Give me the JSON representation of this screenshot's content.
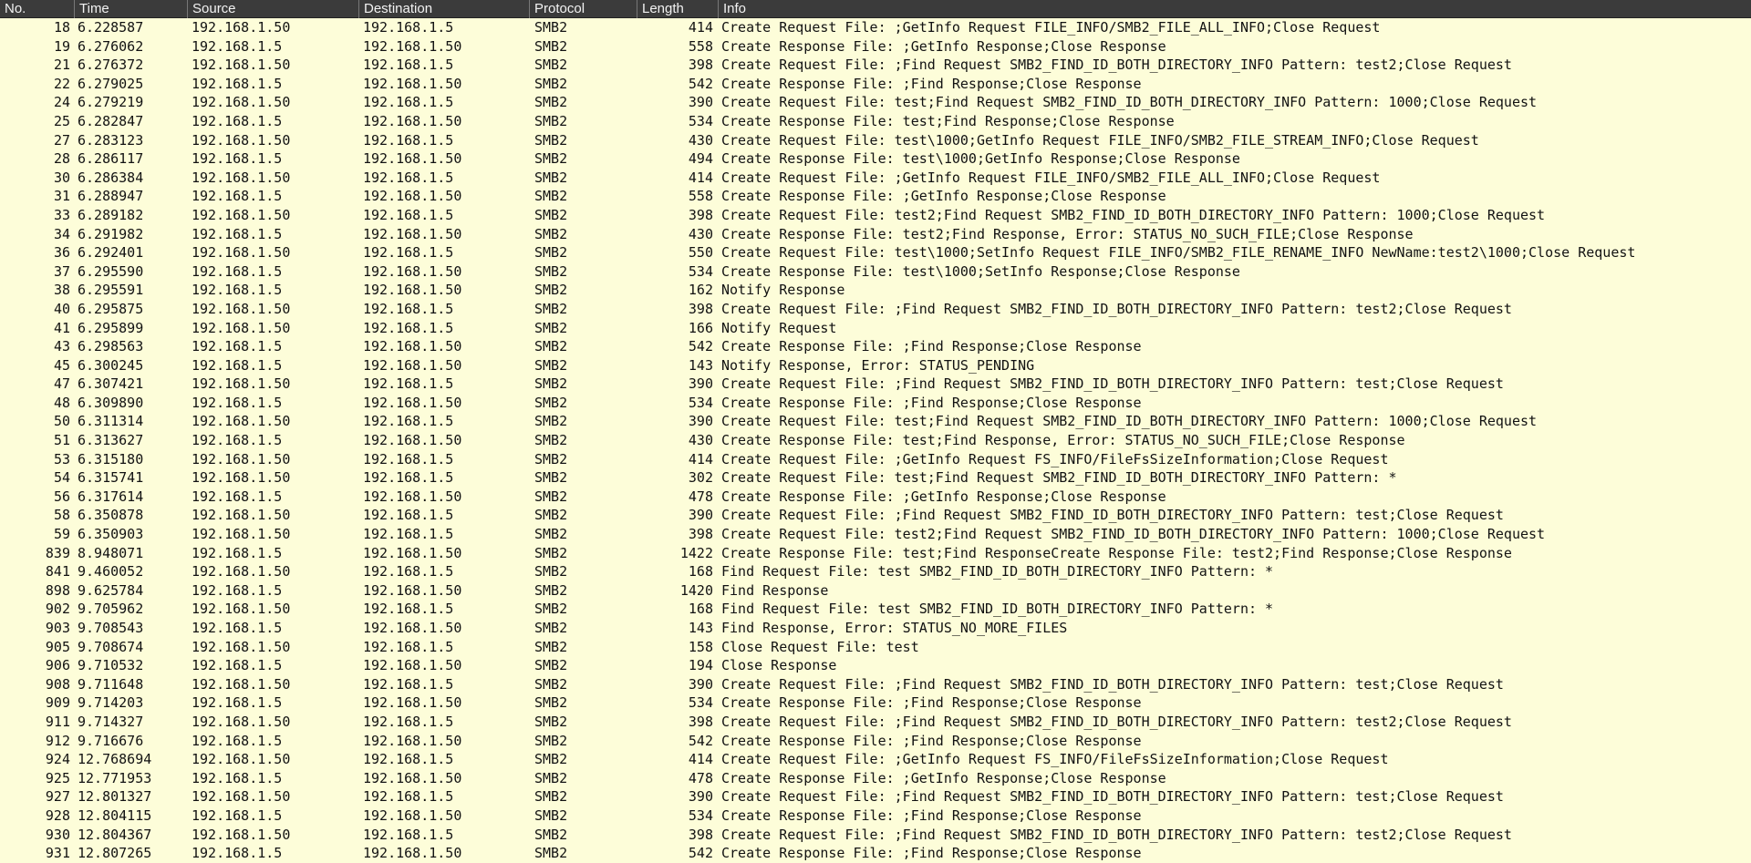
{
  "columns": {
    "no": "No.",
    "time": "Time",
    "source": "Source",
    "destination": "Destination",
    "protocol": "Protocol",
    "length": "Length",
    "info": "Info"
  },
  "colors": {
    "row_bg": "#fdfdd9",
    "header_bg": "#3b3b3b"
  },
  "packets": [
    {
      "no": "18",
      "time": "6.228587",
      "src": "192.168.1.50",
      "dst": "192.168.1.5",
      "proto": "SMB2",
      "len": "414",
      "info": "Create Request File: ;GetInfo Request FILE_INFO/SMB2_FILE_ALL_INFO;Close Request"
    },
    {
      "no": "19",
      "time": "6.276062",
      "src": "192.168.1.5",
      "dst": "192.168.1.50",
      "proto": "SMB2",
      "len": "558",
      "info": "Create Response File: ;GetInfo Response;Close Response"
    },
    {
      "no": "21",
      "time": "6.276372",
      "src": "192.168.1.50",
      "dst": "192.168.1.5",
      "proto": "SMB2",
      "len": "398",
      "info": "Create Request File: ;Find Request SMB2_FIND_ID_BOTH_DIRECTORY_INFO Pattern: test2;Close Request"
    },
    {
      "no": "22",
      "time": "6.279025",
      "src": "192.168.1.5",
      "dst": "192.168.1.50",
      "proto": "SMB2",
      "len": "542",
      "info": "Create Response File: ;Find Response;Close Response"
    },
    {
      "no": "24",
      "time": "6.279219",
      "src": "192.168.1.50",
      "dst": "192.168.1.5",
      "proto": "SMB2",
      "len": "390",
      "info": "Create Request File: test;Find Request SMB2_FIND_ID_BOTH_DIRECTORY_INFO Pattern: 1000;Close Request"
    },
    {
      "no": "25",
      "time": "6.282847",
      "src": "192.168.1.5",
      "dst": "192.168.1.50",
      "proto": "SMB2",
      "len": "534",
      "info": "Create Response File: test;Find Response;Close Response"
    },
    {
      "no": "27",
      "time": "6.283123",
      "src": "192.168.1.50",
      "dst": "192.168.1.5",
      "proto": "SMB2",
      "len": "430",
      "info": "Create Request File: test\\1000;GetInfo Request FILE_INFO/SMB2_FILE_STREAM_INFO;Close Request"
    },
    {
      "no": "28",
      "time": "6.286117",
      "src": "192.168.1.5",
      "dst": "192.168.1.50",
      "proto": "SMB2",
      "len": "494",
      "info": "Create Response File: test\\1000;GetInfo Response;Close Response"
    },
    {
      "no": "30",
      "time": "6.286384",
      "src": "192.168.1.50",
      "dst": "192.168.1.5",
      "proto": "SMB2",
      "len": "414",
      "info": "Create Request File: ;GetInfo Request FILE_INFO/SMB2_FILE_ALL_INFO;Close Request"
    },
    {
      "no": "31",
      "time": "6.288947",
      "src": "192.168.1.5",
      "dst": "192.168.1.50",
      "proto": "SMB2",
      "len": "558",
      "info": "Create Response File: ;GetInfo Response;Close Response"
    },
    {
      "no": "33",
      "time": "6.289182",
      "src": "192.168.1.50",
      "dst": "192.168.1.5",
      "proto": "SMB2",
      "len": "398",
      "info": "Create Request File: test2;Find Request SMB2_FIND_ID_BOTH_DIRECTORY_INFO Pattern: 1000;Close Request"
    },
    {
      "no": "34",
      "time": "6.291982",
      "src": "192.168.1.5",
      "dst": "192.168.1.50",
      "proto": "SMB2",
      "len": "430",
      "info": "Create Response File: test2;Find Response, Error: STATUS_NO_SUCH_FILE;Close Response"
    },
    {
      "no": "36",
      "time": "6.292401",
      "src": "192.168.1.50",
      "dst": "192.168.1.5",
      "proto": "SMB2",
      "len": "550",
      "info": "Create Request File: test\\1000;SetInfo Request FILE_INFO/SMB2_FILE_RENAME_INFO NewName:test2\\1000;Close Request"
    },
    {
      "no": "37",
      "time": "6.295590",
      "src": "192.168.1.5",
      "dst": "192.168.1.50",
      "proto": "SMB2",
      "len": "534",
      "info": "Create Response File: test\\1000;SetInfo Response;Close Response"
    },
    {
      "no": "38",
      "time": "6.295591",
      "src": "192.168.1.5",
      "dst": "192.168.1.50",
      "proto": "SMB2",
      "len": "162",
      "info": "Notify Response"
    },
    {
      "no": "40",
      "time": "6.295875",
      "src": "192.168.1.50",
      "dst": "192.168.1.5",
      "proto": "SMB2",
      "len": "398",
      "info": "Create Request File: ;Find Request SMB2_FIND_ID_BOTH_DIRECTORY_INFO Pattern: test2;Close Request"
    },
    {
      "no": "41",
      "time": "6.295899",
      "src": "192.168.1.50",
      "dst": "192.168.1.5",
      "proto": "SMB2",
      "len": "166",
      "info": "Notify Request"
    },
    {
      "no": "43",
      "time": "6.298563",
      "src": "192.168.1.5",
      "dst": "192.168.1.50",
      "proto": "SMB2",
      "len": "542",
      "info": "Create Response File: ;Find Response;Close Response"
    },
    {
      "no": "45",
      "time": "6.300245",
      "src": "192.168.1.5",
      "dst": "192.168.1.50",
      "proto": "SMB2",
      "len": "143",
      "info": "Notify Response, Error: STATUS_PENDING"
    },
    {
      "no": "47",
      "time": "6.307421",
      "src": "192.168.1.50",
      "dst": "192.168.1.5",
      "proto": "SMB2",
      "len": "390",
      "info": "Create Request File: ;Find Request SMB2_FIND_ID_BOTH_DIRECTORY_INFO Pattern: test;Close Request"
    },
    {
      "no": "48",
      "time": "6.309890",
      "src": "192.168.1.5",
      "dst": "192.168.1.50",
      "proto": "SMB2",
      "len": "534",
      "info": "Create Response File: ;Find Response;Close Response"
    },
    {
      "no": "50",
      "time": "6.311314",
      "src": "192.168.1.50",
      "dst": "192.168.1.5",
      "proto": "SMB2",
      "len": "390",
      "info": "Create Request File: test;Find Request SMB2_FIND_ID_BOTH_DIRECTORY_INFO Pattern: 1000;Close Request"
    },
    {
      "no": "51",
      "time": "6.313627",
      "src": "192.168.1.5",
      "dst": "192.168.1.50",
      "proto": "SMB2",
      "len": "430",
      "info": "Create Response File: test;Find Response, Error: STATUS_NO_SUCH_FILE;Close Response"
    },
    {
      "no": "53",
      "time": "6.315180",
      "src": "192.168.1.50",
      "dst": "192.168.1.5",
      "proto": "SMB2",
      "len": "414",
      "info": "Create Request File: ;GetInfo Request FS_INFO/FileFsSizeInformation;Close Request"
    },
    {
      "no": "54",
      "time": "6.315741",
      "src": "192.168.1.50",
      "dst": "192.168.1.5",
      "proto": "SMB2",
      "len": "302",
      "info": "Create Request File: test;Find Request SMB2_FIND_ID_BOTH_DIRECTORY_INFO Pattern: *"
    },
    {
      "no": "56",
      "time": "6.317614",
      "src": "192.168.1.5",
      "dst": "192.168.1.50",
      "proto": "SMB2",
      "len": "478",
      "info": "Create Response File: ;GetInfo Response;Close Response"
    },
    {
      "no": "58",
      "time": "6.350878",
      "src": "192.168.1.50",
      "dst": "192.168.1.5",
      "proto": "SMB2",
      "len": "390",
      "info": "Create Request File: ;Find Request SMB2_FIND_ID_BOTH_DIRECTORY_INFO Pattern: test;Close Request"
    },
    {
      "no": "59",
      "time": "6.350903",
      "src": "192.168.1.50",
      "dst": "192.168.1.5",
      "proto": "SMB2",
      "len": "398",
      "info": "Create Request File: test2;Find Request SMB2_FIND_ID_BOTH_DIRECTORY_INFO Pattern: 1000;Close Request"
    },
    {
      "no": "839",
      "time": "8.948071",
      "src": "192.168.1.5",
      "dst": "192.168.1.50",
      "proto": "SMB2",
      "len": "1422",
      "info": "Create Response File: test;Find ResponseCreate Response File: test2;Find Response;Close Response"
    },
    {
      "no": "841",
      "time": "9.460052",
      "src": "192.168.1.50",
      "dst": "192.168.1.5",
      "proto": "SMB2",
      "len": "168",
      "info": "Find Request File: test SMB2_FIND_ID_BOTH_DIRECTORY_INFO Pattern: *"
    },
    {
      "no": "898",
      "time": "9.625784",
      "src": "192.168.1.5",
      "dst": "192.168.1.50",
      "proto": "SMB2",
      "len": "1420",
      "info": "Find Response"
    },
    {
      "no": "902",
      "time": "9.705962",
      "src": "192.168.1.50",
      "dst": "192.168.1.5",
      "proto": "SMB2",
      "len": "168",
      "info": "Find Request File: test SMB2_FIND_ID_BOTH_DIRECTORY_INFO Pattern: *"
    },
    {
      "no": "903",
      "time": "9.708543",
      "src": "192.168.1.5",
      "dst": "192.168.1.50",
      "proto": "SMB2",
      "len": "143",
      "info": "Find Response, Error: STATUS_NO_MORE_FILES"
    },
    {
      "no": "905",
      "time": "9.708674",
      "src": "192.168.1.50",
      "dst": "192.168.1.5",
      "proto": "SMB2",
      "len": "158",
      "info": "Close Request File: test"
    },
    {
      "no": "906",
      "time": "9.710532",
      "src": "192.168.1.5",
      "dst": "192.168.1.50",
      "proto": "SMB2",
      "len": "194",
      "info": "Close Response"
    },
    {
      "no": "908",
      "time": "9.711648",
      "src": "192.168.1.50",
      "dst": "192.168.1.5",
      "proto": "SMB2",
      "len": "390",
      "info": "Create Request File: ;Find Request SMB2_FIND_ID_BOTH_DIRECTORY_INFO Pattern: test;Close Request"
    },
    {
      "no": "909",
      "time": "9.714203",
      "src": "192.168.1.5",
      "dst": "192.168.1.50",
      "proto": "SMB2",
      "len": "534",
      "info": "Create Response File: ;Find Response;Close Response"
    },
    {
      "no": "911",
      "time": "9.714327",
      "src": "192.168.1.50",
      "dst": "192.168.1.5",
      "proto": "SMB2",
      "len": "398",
      "info": "Create Request File: ;Find Request SMB2_FIND_ID_BOTH_DIRECTORY_INFO Pattern: test2;Close Request"
    },
    {
      "no": "912",
      "time": "9.716676",
      "src": "192.168.1.5",
      "dst": "192.168.1.50",
      "proto": "SMB2",
      "len": "542",
      "info": "Create Response File: ;Find Response;Close Response"
    },
    {
      "no": "924",
      "time": "12.768694",
      "src": "192.168.1.50",
      "dst": "192.168.1.5",
      "proto": "SMB2",
      "len": "414",
      "info": "Create Request File: ;GetInfo Request FS_INFO/FileFsSizeInformation;Close Request"
    },
    {
      "no": "925",
      "time": "12.771953",
      "src": "192.168.1.5",
      "dst": "192.168.1.50",
      "proto": "SMB2",
      "len": "478",
      "info": "Create Response File: ;GetInfo Response;Close Response"
    },
    {
      "no": "927",
      "time": "12.801327",
      "src": "192.168.1.50",
      "dst": "192.168.1.5",
      "proto": "SMB2",
      "len": "390",
      "info": "Create Request File: ;Find Request SMB2_FIND_ID_BOTH_DIRECTORY_INFO Pattern: test;Close Request"
    },
    {
      "no": "928",
      "time": "12.804115",
      "src": "192.168.1.5",
      "dst": "192.168.1.50",
      "proto": "SMB2",
      "len": "534",
      "info": "Create Response File: ;Find Response;Close Response"
    },
    {
      "no": "930",
      "time": "12.804367",
      "src": "192.168.1.50",
      "dst": "192.168.1.5",
      "proto": "SMB2",
      "len": "398",
      "info": "Create Request File: ;Find Request SMB2_FIND_ID_BOTH_DIRECTORY_INFO Pattern: test2;Close Request"
    },
    {
      "no": "931",
      "time": "12.807265",
      "src": "192.168.1.5",
      "dst": "192.168.1.50",
      "proto": "SMB2",
      "len": "542",
      "info": "Create Response File: ;Find Response;Close Response"
    }
  ]
}
